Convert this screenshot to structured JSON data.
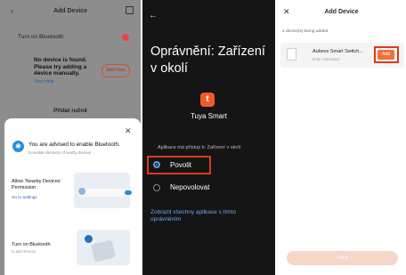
{
  "colors": {
    "accent": "#e0381a",
    "brand_orange": "#ef5a26",
    "link_blue": "#6aa8f0",
    "bluetooth_blue": "#2a8fd8"
  },
  "panel1": {
    "title": "Add Device",
    "back_icon": "back-arrow-icon",
    "scan_icon": "scan-icon",
    "bluetooth_row": "Turn on Bluetooth",
    "message": "No device is found.\nPlease try adding a\ndevice manually.",
    "add_button": "Add Now",
    "help_link": "View Help",
    "manual_label": "Přidat ručně",
    "sheet": {
      "close_icon": "close-icon",
      "bluetooth_icon": "bluetooth-icon",
      "advice": "You are advised to enable Bluetooth.",
      "advice_sub": "to enable discovery of nearby devices",
      "permission_label": "Allow 'Nearby Devices'\nPermission",
      "permission_link": "Go to Settings",
      "bluetooth_label": "Turn on Bluetooth",
      "bluetooth_sub": "to add devices"
    }
  },
  "panel2": {
    "back_icon": "back-arrow-icon",
    "title": "Oprávnění: Zařízení\nv okolí",
    "app_logo": "t",
    "app_name": "Tuya Smart",
    "question": "Aplikace má přístup k: Zařízení v okolí",
    "options": [
      {
        "label": "Povolit",
        "selected": true
      },
      {
        "label": "Nepovolovat",
        "selected": false
      }
    ],
    "link": "Zobrazit všechny aplikace s tímto\noprávněním"
  },
  "panel3": {
    "close_icon": "close-icon",
    "title": "Add Device",
    "section": "1 device(s) being added",
    "device_name": "Aubess Smart Switch...",
    "device_sub": "to be connected",
    "add_button": "Add",
    "bottom_button": "Done"
  }
}
